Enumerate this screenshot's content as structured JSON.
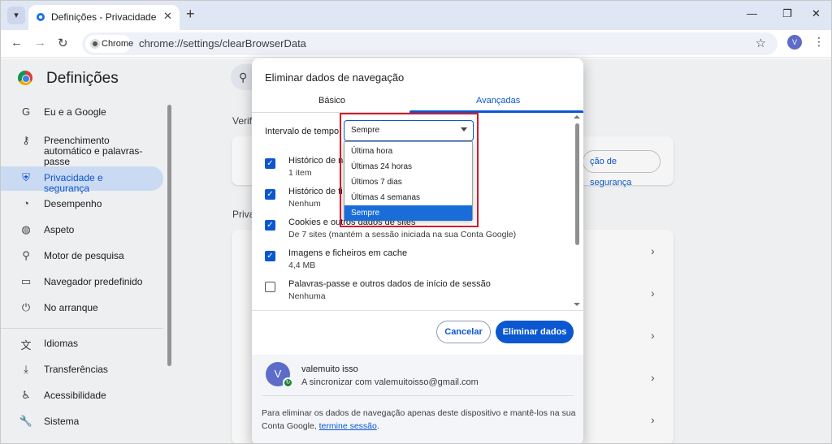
{
  "browser": {
    "tab_title": "Definições - Privacidade e segu",
    "tab_close": "✕",
    "new_tab": "+",
    "chip_label": "Chrome",
    "url": "chrome://settings/clearBrowserData",
    "profile_initial": "V",
    "window_buttons": [
      "—",
      "❐",
      "✕"
    ],
    "icons": [
      "chevron-down-icon",
      "chrome-icon",
      "close-icon",
      "plus-icon",
      "back-icon",
      "forward-icon",
      "reload-icon",
      "star-icon",
      "kebab-icon"
    ]
  },
  "settings": {
    "title": "Definições",
    "sidebar": [
      {
        "icon": "G",
        "label": "Eu e a Google"
      },
      {
        "icon": "⚷",
        "label": "Preenchimento automático e palavras-passe"
      },
      {
        "icon": "⛨",
        "label": "Privacidade e segurança",
        "active": true
      },
      {
        "icon": "◔",
        "label": "Desempenho"
      },
      {
        "icon": "◍",
        "label": "Aspeto"
      },
      {
        "icon": "⚲",
        "label": "Motor de pesquisa"
      },
      {
        "icon": "▭",
        "label": "Navegador predefinido"
      },
      {
        "icon": "⏻",
        "label": "No arranque"
      },
      {
        "icon": "文",
        "label": "Idiomas"
      },
      {
        "icon": "⤓",
        "label": "Transferências"
      },
      {
        "icon": "♿",
        "label": "Acessibilidade"
      },
      {
        "icon": "🔧",
        "label": "Sistema"
      }
    ],
    "bg_verif": "Verif",
    "bg_priva": "Priva",
    "bg_pill": "ção de segurança"
  },
  "dialog": {
    "title": "Eliminar dados de navegação",
    "tabs": [
      "Básico",
      "Avançadas"
    ],
    "active_tab": "Avançadas",
    "range_label": "Intervalo de tempo",
    "range_value": "Sempre",
    "range_options": [
      "Última hora",
      "Últimas 24 horas",
      "Últimos 7 dias",
      "Últimas 4 semanas",
      "Sempre"
    ],
    "items": [
      {
        "title": "Histórico de na",
        "sub": "1 item",
        "checked": true
      },
      {
        "title": "Histórico de ti",
        "sub": "Nenhum",
        "checked": true
      },
      {
        "title": "Cookies e outros dados de sites",
        "sub": "De 7 sites (mantém a sessão iniciada na sua Conta Google)",
        "checked": true
      },
      {
        "title": "Imagens e ficheiros em cache",
        "sub": "4,4 MB",
        "checked": true
      },
      {
        "title": "Palavras-passe e outros dados de início de sessão",
        "sub": "Nenhuma",
        "checked": false
      }
    ],
    "check_glyph": "✓",
    "cancel_label": "Cancelar",
    "clear_label": "Eliminar dados",
    "account": {
      "initial": "V",
      "name": "valemuito isso",
      "sync_text": "A sincronizar com valemuitoisso@gmail.com",
      "sync_glyph": "↻"
    },
    "note_text": "Para eliminar os dados de navegação apenas deste dispositivo e mantê-los na sua Conta Google, ",
    "note_link": "termine sessão",
    "note_end": "."
  },
  "colors": {
    "accent": "#0b57d0",
    "highlight_box": "#d6182b",
    "selected_option": "#1a6dd9"
  }
}
